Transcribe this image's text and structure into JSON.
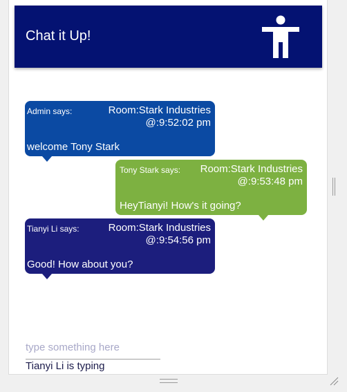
{
  "app": {
    "title": "Chat it Up!",
    "header_icon": "accessibility-person-icon",
    "header_color": "#041272"
  },
  "messages": [
    {
      "sender": "Admin says:",
      "room": "Room:Stark Industries",
      "time": "@:9:52:02 pm",
      "text": "welcome Tony Stark",
      "color": "#0b4aa3"
    },
    {
      "sender": "Tony Stark says:",
      "room": "Room:Stark Industries",
      "time": "@:9:53:48 pm",
      "text": "HeyTianyi! How's it going?",
      "color": "#7db141"
    },
    {
      "sender": "Tianyi Li says:",
      "room": "Room:Stark Industries",
      "time": "@:9:54:56 pm",
      "text": "Good! How about you?",
      "color": "#1c1e7d"
    }
  ],
  "composer": {
    "placeholder": "type something here",
    "value": ""
  },
  "status": {
    "typing_text": "Tianyi Li is typing"
  }
}
